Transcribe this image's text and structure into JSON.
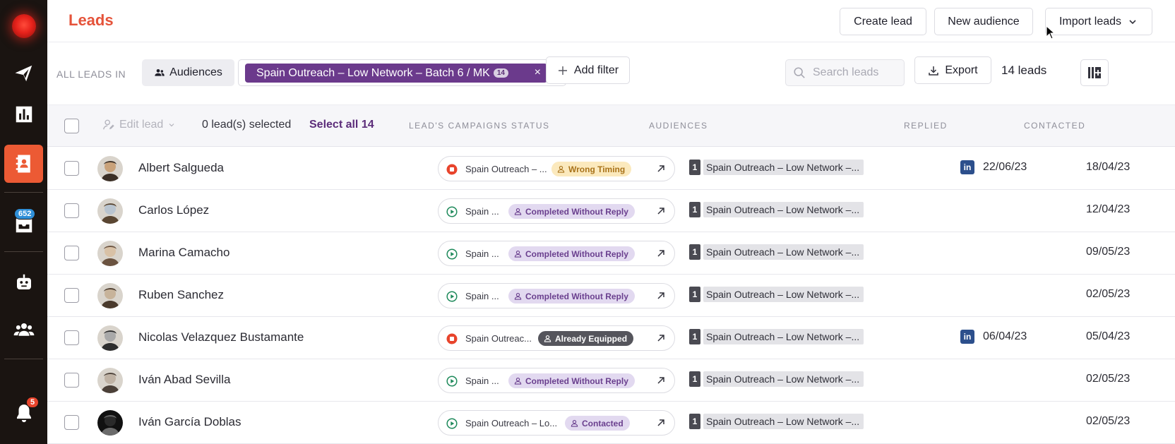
{
  "sidebar": {
    "inbox_badge": "652",
    "notifications_badge": "5",
    "items": [
      {
        "icon": "paper-plane-icon",
        "label": "Campaigns"
      },
      {
        "icon": "bar-chart-icon",
        "label": "Analytics"
      },
      {
        "icon": "contacts-book-icon",
        "label": "Leads",
        "active": true
      },
      {
        "icon": "inbox-icon",
        "label": "Inbox"
      },
      {
        "icon": "robot-icon",
        "label": "Automation"
      },
      {
        "icon": "team-icon",
        "label": "Team"
      },
      {
        "icon": "bell-icon",
        "label": "Notifications"
      }
    ]
  },
  "header": {
    "title": "Leads",
    "create_lead": "Create lead",
    "new_audience": "New audience",
    "import_leads": "Import leads"
  },
  "filters": {
    "all_leads_in": "ALL LEADS IN",
    "audiences_label": "Audiences",
    "selected_audience": "Spain Outreach – Low Network – Batch 6 / MK",
    "selected_audience_count": "14",
    "remove": "×",
    "add_filter": "Add filter",
    "search_placeholder": "Search leads",
    "export": "Export",
    "leads_count": "14 leads"
  },
  "table": {
    "edit_lead": "Edit lead",
    "selected": "0 lead(s) selected",
    "select_all": "Select all 14",
    "columns": {
      "campaigns_status": "LEAD'S CAMPAIGNS STATUS",
      "audiences": "AUDIENCES",
      "replied": "REPLIED",
      "contacted": "CONTACTED"
    },
    "rows": [
      {
        "name": "Albert Salgueda",
        "campaign": "Spain Outreach – ...",
        "state": "stopped",
        "status": "Wrong Timing",
        "tone": "yellow",
        "aud_num": "1",
        "audience": "Spain Outreach – Low Network –...",
        "replied": "22/06/23",
        "contacted": "18/04/23"
      },
      {
        "name": "Carlos López",
        "campaign": "Spain ...",
        "state": "running",
        "status": "Completed Without Reply",
        "tone": "purple",
        "aud_num": "1",
        "audience": "Spain Outreach – Low Network –...",
        "replied": "",
        "contacted": "12/04/23"
      },
      {
        "name": "Marina Camacho",
        "campaign": "Spain ...",
        "state": "running",
        "status": "Completed Without Reply",
        "tone": "purple",
        "aud_num": "1",
        "audience": "Spain Outreach – Low Network –...",
        "replied": "",
        "contacted": "09/05/23"
      },
      {
        "name": "Ruben Sanchez",
        "campaign": "Spain ...",
        "state": "running",
        "status": "Completed Without Reply",
        "tone": "purple",
        "aud_num": "1",
        "audience": "Spain Outreach – Low Network –...",
        "replied": "",
        "contacted": "02/05/23"
      },
      {
        "name": "Nicolas Velazquez Bustamante",
        "campaign": "Spain Outreac...",
        "state": "stopped",
        "status": "Already Equipped",
        "tone": "dark",
        "aud_num": "1",
        "audience": "Spain Outreach – Low Network –...",
        "replied": "06/04/23",
        "contacted": "05/04/23"
      },
      {
        "name": "Iván Abad Sevilla",
        "campaign": "Spain ...",
        "state": "running",
        "status": "Completed Without Reply",
        "tone": "purple",
        "aud_num": "1",
        "audience": "Spain Outreach – Low Network –...",
        "replied": "",
        "contacted": "02/05/23"
      },
      {
        "name": "Iván García Doblas",
        "campaign": "Spain Outreach – Lo...",
        "state": "running",
        "status": "Contacted",
        "tone": "purple",
        "aud_num": "1",
        "audience": "Spain Outreach – Low Network –...",
        "replied": "",
        "contacted": "02/05/23"
      }
    ]
  },
  "colors": {
    "brand": "#e5533a",
    "sidebar_bg": "#1a1411",
    "audience_chip": "#6b3a8c"
  }
}
